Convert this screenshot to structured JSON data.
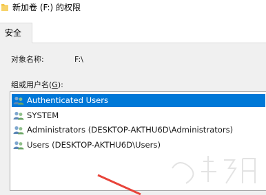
{
  "window": {
    "title": "新加卷 (F:) 的权限",
    "icon": "folder-icon"
  },
  "tabs": [
    {
      "label": "安全",
      "active": true
    }
  ],
  "object": {
    "label": "对象名称:",
    "value": "F:\\"
  },
  "groups": {
    "label_prefix": "组或用户名(",
    "label_accel": "G",
    "label_suffix": "):",
    "items": [
      {
        "label": "Authenticated Users",
        "icon": "users-group-icon",
        "selected": true
      },
      {
        "label": "SYSTEM",
        "icon": "users-group-icon",
        "selected": false
      },
      {
        "label": "Administrators (DESKTOP-AKTHU6D\\Administrators)",
        "icon": "users-group-icon",
        "selected": false
      },
      {
        "label": "Users (DESKTOP-AKTHU6D\\Users)",
        "icon": "users-group-icon",
        "selected": false
      }
    ]
  },
  "colors": {
    "selection": "#0078d7",
    "dialog_bg": "#f0f0f0",
    "folder": "#f4c542",
    "arrow": "#e8443a"
  }
}
